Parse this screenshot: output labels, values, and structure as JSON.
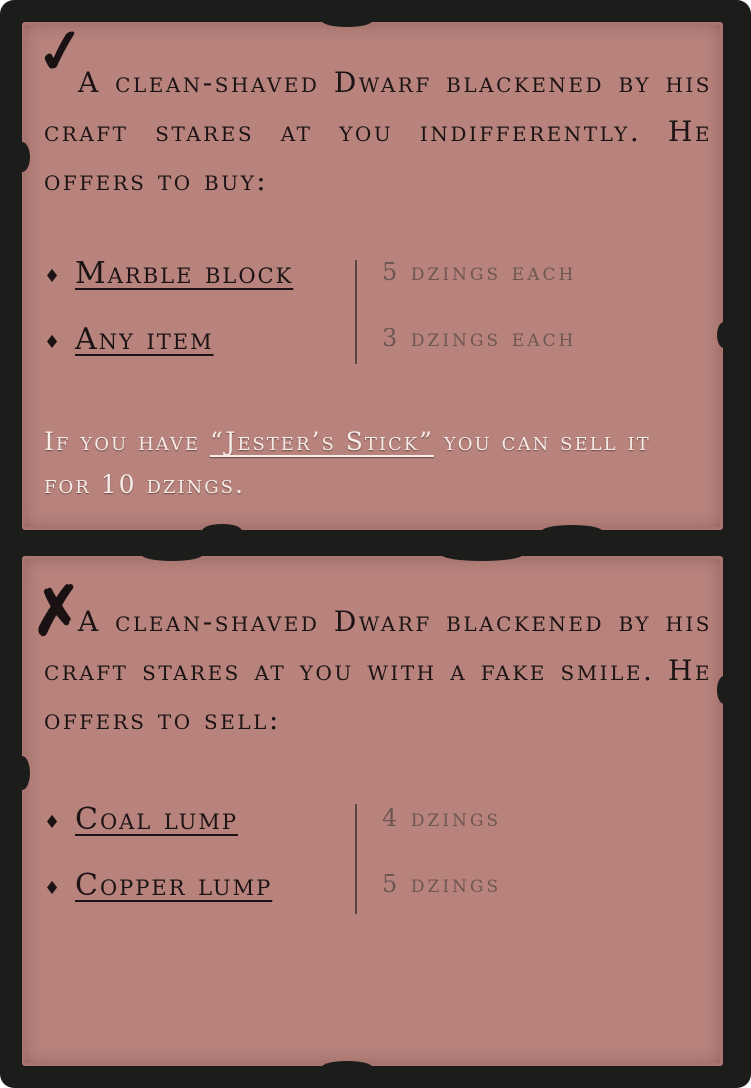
{
  "buy_section": {
    "description": "A clean-shaved Dwarf blackened by his craft stares at you indifferently. He offers to buy:",
    "items": [
      {
        "name": "Marble block",
        "price": "5 dzings each"
      },
      {
        "name": "Any item",
        "price": "3 dzings each"
      }
    ],
    "note": {
      "prefix": "If you have ",
      "link": "“Jester’s Stick”",
      "suffix": " you can sell it for 10 dzings."
    }
  },
  "sell_section": {
    "description": "A clean-shaved Dwarf blackened by his craft stares at you with a fake smile. He offers to sell:",
    "items": [
      {
        "name": "Coal lump",
        "price": "4 dzings"
      },
      {
        "name": "Copper lump",
        "price": "5 dzings"
      }
    ]
  },
  "icons": {
    "top_mark": "checkmark-icon",
    "bottom_mark": "cross-icon",
    "bullet": "diamond-bullet-icon"
  }
}
